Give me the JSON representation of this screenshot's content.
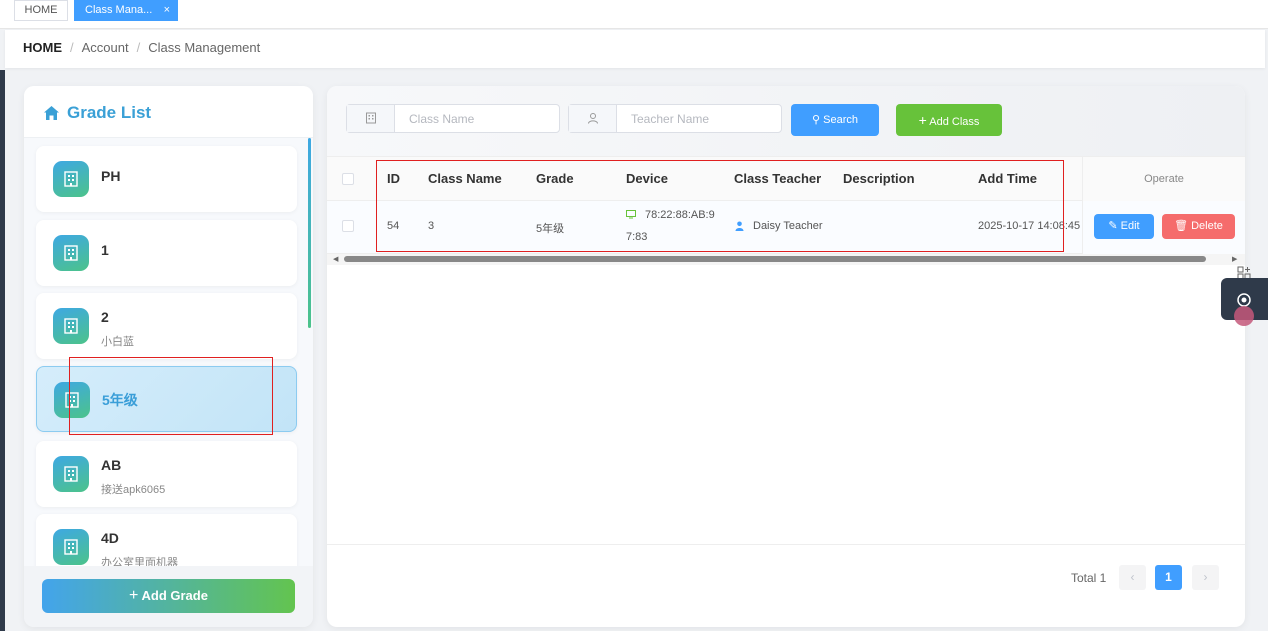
{
  "tabs": [
    {
      "label": "HOME"
    },
    {
      "label": "Class Mana...",
      "close": "×"
    }
  ],
  "breadcrumb": {
    "home": "HOME",
    "sep": "/",
    "items": [
      "Account",
      "Class Management"
    ]
  },
  "grade_list": {
    "title": "Grade List",
    "items": [
      {
        "name": "PH",
        "sub": ""
      },
      {
        "name": "1",
        "sub": ""
      },
      {
        "name": "2",
        "sub": "小白蓝"
      },
      {
        "name": "5年级",
        "sub": "",
        "selected": true
      },
      {
        "name": "AB",
        "sub": "接送apk6065"
      },
      {
        "name": "4D",
        "sub": "办公室里面机器"
      }
    ],
    "add_button": "Add Grade"
  },
  "search": {
    "class_name_placeholder": "Class Name",
    "teacher_name_placeholder": "Teacher Name",
    "search_button": "Search",
    "add_class_button": "Add Class"
  },
  "table": {
    "headers": [
      "ID",
      "Class Name",
      "Grade",
      "Device",
      "Class Teacher",
      "Description",
      "Add Time",
      "Operate"
    ],
    "rows": [
      {
        "id": "54",
        "class_name": "3",
        "grade": "5年级",
        "device_line1": "78:22:88:AB:9",
        "device_line2": "7:83",
        "teacher": "Daisy Teacher",
        "description": "",
        "add_time": "2025-10-17 14:08:45",
        "edit": "Edit",
        "delete": "Delete"
      }
    ]
  },
  "pagination": {
    "total": "Total 1",
    "current": "1",
    "prev": "‹",
    "next": "›"
  },
  "colors": {
    "primary": "#409eff",
    "success": "#67c23a",
    "danger": "#f56c6c",
    "annotation": "#e02020"
  },
  "icons": [
    "home-icon",
    "building-icon",
    "user-icon",
    "search-icon",
    "plus-icon",
    "monitor-icon",
    "person-icon",
    "edit-icon",
    "trash-icon",
    "gear-icon",
    "grid-icon"
  ]
}
